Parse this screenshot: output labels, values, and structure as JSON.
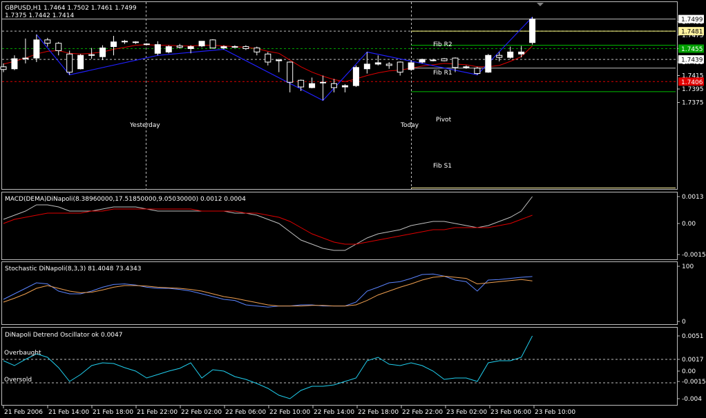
{
  "colors": {
    "background": "#000000",
    "grid": "#c0c0c0",
    "frame": "#c0c0c0",
    "candle_up": "#ffffff",
    "candle_down": "#000000",
    "candle_outline": "#ffffff",
    "ma_line": "#e00000",
    "zigzag": "#2020ff",
    "macd_main": "#c0c0c0",
    "macd_signal": "#e00000",
    "stoch_main": "#5b84ff",
    "stoch_signal": "#f0a050",
    "detrend": "#20d0f0",
    "fib_line": "#00c000",
    "pivot_line": "#c0c0c0",
    "fib_r2_line": "#ffff80",
    "bid_tag": "#ffffff",
    "ask_tag": "#fff3a0",
    "green_tag": "#00a000",
    "red_tag": "#e00000"
  },
  "main_panel": {
    "header_line1": "GBPUSD,H1  1.7464 1.7502 1.7461 1.7499",
    "header_line2": "1.7375 1.7442 1.7414",
    "price_ticks": [
      "1.7495",
      "1.7475",
      "1.7455",
      "1.7435",
      "1.7415",
      "1.7395",
      "1.7375"
    ],
    "tags": [
      {
        "text": "1.7499",
        "price": 1.7499,
        "kind": "white"
      },
      {
        "text": "1.7481",
        "price": 1.7481,
        "kind": "yellow"
      },
      {
        "text": "1.7455",
        "price": 1.7455,
        "kind": "green"
      },
      {
        "text": "1.7439",
        "price": 1.7439,
        "kind": "white"
      },
      {
        "text": "1.7406",
        "price": 1.7406,
        "kind": "red"
      }
    ],
    "labels": {
      "yesterday": "Yesterday",
      "today": "Today",
      "fib_r2": "Fib R2",
      "fib_r1": "Fib R1",
      "pivot": "Pivot",
      "fib_s1": "Fib S1"
    },
    "levels": {
      "fib_r2": 1.7481,
      "fib_r1": 1.746,
      "pivot": 1.7426,
      "fib_s1": 1.7391
    }
  },
  "macd_panel": {
    "header": "MACD(DEMA)DiNapoli(8.38960000,17.51850000,9.05030000) 0.0012 0.0004",
    "ticks": [
      "0.0013",
      "0.00",
      "-0.0015"
    ]
  },
  "stoch_panel": {
    "header": "Stochastic DiNapoli(8,3,3) 81.4048 73.4343",
    "ticks": [
      "100",
      "0"
    ]
  },
  "detrend_panel": {
    "header": "DiNapoli Detrend Oscillator ok 0.0047",
    "overbought": "Overbaught",
    "oversold": "Oversold",
    "ticks": [
      "0.0051",
      "0.0017",
      "0.00",
      "-0.0015",
      "-0.004"
    ]
  },
  "time_axis": [
    "21 Feb 2006",
    "21 Feb 14:00",
    "21 Feb 18:00",
    "21 Feb 22:00",
    "22 Feb 02:00",
    "22 Feb 06:00",
    "22 Feb 10:00",
    "22 Feb 14:00",
    "22 Feb 18:00",
    "22 Feb 22:00",
    "23 Feb 02:00",
    "23 Feb 06:00",
    "23 Feb 10:00"
  ],
  "chart_data": {
    "type": "candlestick",
    "symbol": "GBPUSD",
    "timeframe": "H1",
    "bar_count": 49,
    "ylim": [
      1.7365,
      1.7505
    ],
    "candles": [
      {
        "o": 1.7428,
        "h": 1.7433,
        "l": 1.742,
        "c": 1.7424
      },
      {
        "o": 1.7425,
        "h": 1.7445,
        "l": 1.7423,
        "c": 1.744
      },
      {
        "o": 1.744,
        "h": 1.747,
        "l": 1.7433,
        "c": 1.7441
      },
      {
        "o": 1.7441,
        "h": 1.7476,
        "l": 1.7435,
        "c": 1.7468
      },
      {
        "o": 1.7468,
        "h": 1.7471,
        "l": 1.7458,
        "c": 1.7463
      },
      {
        "o": 1.7463,
        "h": 1.7465,
        "l": 1.7445,
        "c": 1.7452
      },
      {
        "o": 1.7447,
        "h": 1.7452,
        "l": 1.7416,
        "c": 1.742
      },
      {
        "o": 1.7425,
        "h": 1.7447,
        "l": 1.7424,
        "c": 1.7445
      },
      {
        "o": 1.7445,
        "h": 1.7456,
        "l": 1.744,
        "c": 1.7446
      },
      {
        "o": 1.7443,
        "h": 1.746,
        "l": 1.7438,
        "c": 1.7456
      },
      {
        "o": 1.7458,
        "h": 1.7474,
        "l": 1.7445,
        "c": 1.7465
      },
      {
        "o": 1.7465,
        "h": 1.7468,
        "l": 1.7462,
        "c": 1.7466
      },
      {
        "o": 1.7465,
        "h": 1.7466,
        "l": 1.7462,
        "c": 1.7464
      },
      {
        "o": 1.7462,
        "h": 1.7463,
        "l": 1.746,
        "c": 1.7462
      },
      {
        "o": 1.7448,
        "h": 1.7466,
        "l": 1.7445,
        "c": 1.7461
      },
      {
        "o": 1.745,
        "h": 1.746,
        "l": 1.7448,
        "c": 1.7458
      },
      {
        "o": 1.7459,
        "h": 1.7462,
        "l": 1.7455,
        "c": 1.7457
      },
      {
        "o": 1.7455,
        "h": 1.746,
        "l": 1.7448,
        "c": 1.7458
      },
      {
        "o": 1.7459,
        "h": 1.7466,
        "l": 1.7457,
        "c": 1.7466
      },
      {
        "o": 1.7468,
        "h": 1.7469,
        "l": 1.7455,
        "c": 1.7456
      },
      {
        "o": 1.7456,
        "h": 1.746,
        "l": 1.7454,
        "c": 1.7458
      },
      {
        "o": 1.7458,
        "h": 1.746,
        "l": 1.7456,
        "c": 1.7457
      },
      {
        "o": 1.7458,
        "h": 1.746,
        "l": 1.7453,
        "c": 1.7455
      },
      {
        "o": 1.7456,
        "h": 1.7458,
        "l": 1.7445,
        "c": 1.745
      },
      {
        "o": 1.7447,
        "h": 1.745,
        "l": 1.743,
        "c": 1.7435
      },
      {
        "o": 1.7438,
        "h": 1.744,
        "l": 1.742,
        "c": 1.7437
      },
      {
        "o": 1.7435,
        "h": 1.7436,
        "l": 1.739,
        "c": 1.7405
      },
      {
        "o": 1.7408,
        "h": 1.7409,
        "l": 1.7392,
        "c": 1.7398
      },
      {
        "o": 1.7397,
        "h": 1.7412,
        "l": 1.7396,
        "c": 1.7403
      },
      {
        "o": 1.7405,
        "h": 1.7415,
        "l": 1.7378,
        "c": 1.7405
      },
      {
        "o": 1.7403,
        "h": 1.741,
        "l": 1.739,
        "c": 1.7397
      },
      {
        "o": 1.7398,
        "h": 1.7402,
        "l": 1.739,
        "c": 1.74
      },
      {
        "o": 1.74,
        "h": 1.743,
        "l": 1.7398,
        "c": 1.7427
      },
      {
        "o": 1.7425,
        "h": 1.745,
        "l": 1.7418,
        "c": 1.7432
      },
      {
        "o": 1.7432,
        "h": 1.7445,
        "l": 1.743,
        "c": 1.7434
      },
      {
        "o": 1.7432,
        "h": 1.7435,
        "l": 1.7425,
        "c": 1.743
      },
      {
        "o": 1.7435,
        "h": 1.7436,
        "l": 1.7415,
        "c": 1.742
      },
      {
        "o": 1.7424,
        "h": 1.7438,
        "l": 1.7422,
        "c": 1.7434
      },
      {
        "o": 1.7435,
        "h": 1.744,
        "l": 1.7433,
        "c": 1.7439
      },
      {
        "o": 1.7438,
        "h": 1.744,
        "l": 1.7436,
        "c": 1.7437
      },
      {
        "o": 1.744,
        "h": 1.7441,
        "l": 1.7436,
        "c": 1.7437
      },
      {
        "o": 1.7441,
        "h": 1.7442,
        "l": 1.742,
        "c": 1.7427
      },
      {
        "o": 1.7428,
        "h": 1.743,
        "l": 1.7425,
        "c": 1.7427
      },
      {
        "o": 1.7426,
        "h": 1.7428,
        "l": 1.7416,
        "c": 1.7418
      },
      {
        "o": 1.742,
        "h": 1.7447,
        "l": 1.7419,
        "c": 1.7445
      },
      {
        "o": 1.7445,
        "h": 1.745,
        "l": 1.7436,
        "c": 1.7442
      },
      {
        "o": 1.7442,
        "h": 1.7458,
        "l": 1.744,
        "c": 1.745
      },
      {
        "o": 1.7447,
        "h": 1.7459,
        "l": 1.7442,
        "c": 1.745
      },
      {
        "o": 1.7464,
        "h": 1.7502,
        "l": 1.7461,
        "c": 1.7499
      }
    ],
    "ma": [
      1.7432,
      1.7436,
      1.7441,
      1.7447,
      1.7451,
      1.7452,
      1.7448,
      1.7447,
      1.7448,
      1.745,
      1.7454,
      1.7457,
      1.746,
      1.7461,
      1.746,
      1.746,
      1.7459,
      1.7459,
      1.746,
      1.746,
      1.7459,
      1.7458,
      1.7457,
      1.7455,
      1.7451,
      1.7448,
      1.7438,
      1.7428,
      1.742,
      1.7414,
      1.7409,
      1.7406,
      1.741,
      1.7415,
      1.7419,
      1.7422,
      1.7423,
      1.7426,
      1.7429,
      1.7431,
      1.7433,
      1.7432,
      1.7431,
      1.7428,
      1.7428,
      1.743,
      1.7436,
      1.7443,
      1.7459
    ],
    "zigzag": [
      [
        3,
        1.7476
      ],
      [
        6,
        1.7416
      ],
      [
        14,
        1.7445
      ],
      [
        20,
        1.7454
      ],
      [
        29,
        1.7378
      ],
      [
        33,
        1.745
      ],
      [
        43,
        1.7416
      ],
      [
        48,
        1.7502
      ]
    ],
    "macd_main": [
      0.0002,
      0.0004,
      0.0006,
      0.0009,
      0.0009,
      0.0008,
      0.0006,
      0.0006,
      0.0006,
      0.0007,
      0.0008,
      0.0008,
      0.0008,
      0.0007,
      0.0006,
      0.0006,
      0.0006,
      0.0006,
      0.0006,
      0.0006,
      0.0006,
      0.0005,
      0.0005,
      0.0004,
      0.0002,
      0.0,
      -0.0004,
      -0.0008,
      -0.001,
      -0.0012,
      -0.0013,
      -0.0013,
      -0.001,
      -0.0007,
      -0.0005,
      -0.0004,
      -0.0003,
      -0.0001,
      0.0,
      0.0001,
      0.0001,
      0.0,
      -0.0001,
      -0.0002,
      -0.0001,
      0.0001,
      0.0003,
      0.0006,
      0.0013
    ],
    "macd_signal": [
      0.0,
      0.0002,
      0.0003,
      0.0004,
      0.0005,
      0.0005,
      0.0005,
      0.0005,
      0.0006,
      0.0006,
      0.0007,
      0.0007,
      0.0007,
      0.0007,
      0.0007,
      0.0007,
      0.0007,
      0.0007,
      0.0006,
      0.0006,
      0.0006,
      0.0006,
      0.0005,
      0.0005,
      0.0004,
      0.0003,
      0.0001,
      -0.0002,
      -0.0005,
      -0.0007,
      -0.0009,
      -0.001,
      -0.001,
      -0.0009,
      -0.0008,
      -0.0007,
      -0.0006,
      -0.0005,
      -0.0004,
      -0.0003,
      -0.0003,
      -0.0002,
      -0.0002,
      -0.0002,
      -0.0002,
      -0.0001,
      0.0,
      0.0002,
      0.0004
    ],
    "stoch_main": [
      40,
      50,
      60,
      70,
      68,
      55,
      50,
      50,
      55,
      62,
      67,
      68,
      66,
      62,
      60,
      60,
      58,
      55,
      50,
      45,
      40,
      38,
      30,
      28,
      26,
      28,
      28,
      30,
      30,
      28,
      28,
      28,
      35,
      55,
      62,
      70,
      72,
      78,
      85,
      86,
      82,
      75,
      72,
      55,
      75,
      76,
      78,
      80,
      81.4
    ],
    "stoch_signal": [
      35,
      42,
      50,
      60,
      65,
      60,
      55,
      52,
      53,
      57,
      62,
      65,
      65,
      64,
      62,
      61,
      60,
      58,
      55,
      50,
      45,
      42,
      38,
      34,
      30,
      28,
      28,
      28,
      29,
      29,
      28,
      28,
      30,
      38,
      48,
      55,
      62,
      68,
      75,
      80,
      82,
      80,
      78,
      68,
      70,
      72,
      74,
      76,
      73.4
    ],
    "detrend": [
      0.0015,
      0.0008,
      0.0017,
      0.0025,
      0.002,
      0.0005,
      -0.0015,
      -0.0005,
      0.0008,
      0.0012,
      0.0011,
      0.0005,
      0.0,
      -0.001,
      -0.0005,
      0.0,
      0.0004,
      0.0012,
      -0.001,
      0.0002,
      0.0,
      -0.0008,
      -0.0012,
      -0.0018,
      -0.0025,
      -0.0035,
      -0.004,
      -0.0028,
      -0.0022,
      -0.0022,
      -0.002,
      -0.0015,
      -0.001,
      0.0015,
      0.002,
      0.001,
      0.0008,
      0.0012,
      0.0008,
      0.0,
      -0.0012,
      -0.001,
      -0.001,
      -0.0015,
      0.0012,
      0.0015,
      0.0015,
      0.002,
      0.0051
    ]
  }
}
